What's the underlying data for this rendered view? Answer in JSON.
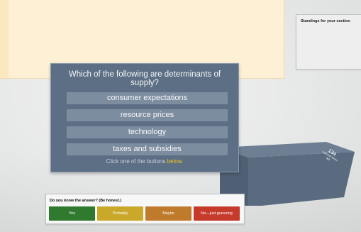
{
  "standings": {
    "title": "Standings for your section"
  },
  "block": {
    "count": "134",
    "sublabel": "national items left"
  },
  "question": {
    "text": "Which of the following are determinants of supply?",
    "answers": [
      {
        "label": "consumer expectations"
      },
      {
        "label": "resource prices"
      },
      {
        "label": "technology"
      },
      {
        "label": "taxes and subsidies"
      }
    ],
    "hint_prefix": "Click one of the buttons ",
    "hint_link": "below",
    "hint_suffix": "."
  },
  "confidence": {
    "title": "Do you know the answer? (Be honest.)",
    "buttons": [
      {
        "label": "Yes",
        "color": "#2f7a2f"
      },
      {
        "label": "Probably",
        "color": "#c9a82a"
      },
      {
        "label": "Maybe",
        "color": "#c07a2c"
      },
      {
        "label": "No—just guessing",
        "color": "#c63a2c"
      }
    ]
  }
}
